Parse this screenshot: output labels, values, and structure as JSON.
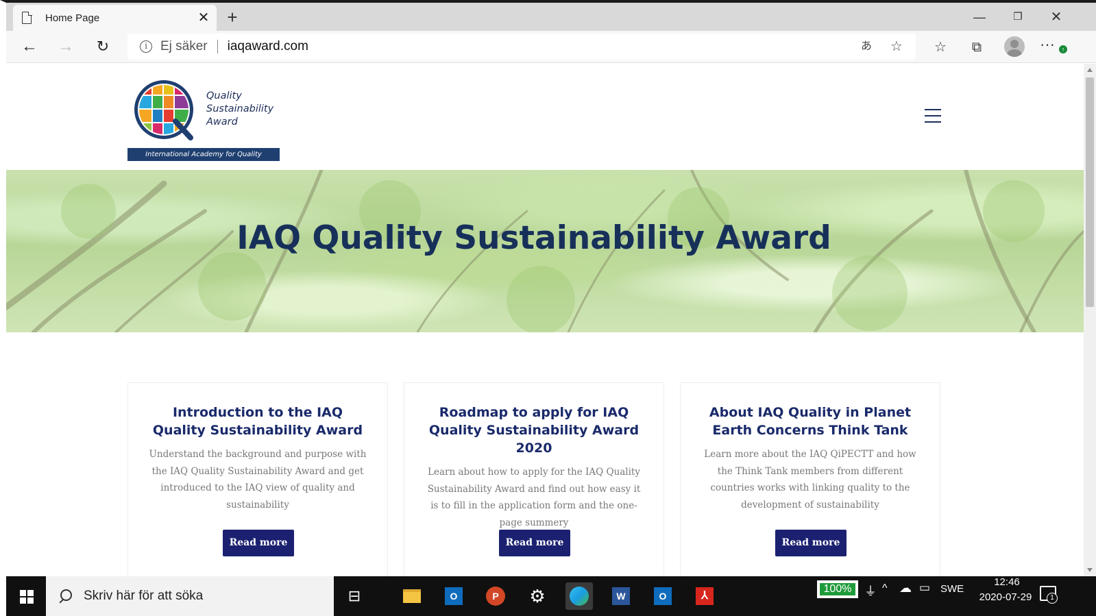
{
  "browser": {
    "tab_title": "Home Page",
    "security_label": "Ej säker",
    "url": "iaqaward.com",
    "icons": [
      "page-icon",
      "close-icon",
      "plus-icon",
      "back-arrow-icon",
      "forward-arrow-icon",
      "refresh-icon",
      "info-icon",
      "translate-icon",
      "star-icon",
      "favorites-icon",
      "collections-icon",
      "profile-icon",
      "more-icon"
    ]
  },
  "site": {
    "logo": {
      "line1": "Quality",
      "line2": "Sustainability",
      "line3": "Award",
      "tagline": "International Academy for Quality"
    },
    "hero_title": "IAQ Quality Sustainability Award",
    "cards": [
      {
        "title": "Introduction to the IAQ Quality Sustainability Award",
        "body": "Understand the background and purpose with the IAQ Quality Sustainability Award and get introduced to the IAQ view of quality and sustainability",
        "button": "Read more"
      },
      {
        "title": "Roadmap to apply for IAQ Quality Sustainability Award 2020",
        "body": "Learn about how to apply for the IAQ Quality Sustainability Award and find out how easy it is to fill in the application form and the one-page summery",
        "button": "Read more"
      },
      {
        "title": "About IAQ Quality in Planet Earth Concerns Think Tank",
        "body": "Learn more about the IAQ QiPECTT and how the Think Tank members from different countries works with linking quality to the development of sustainability",
        "button": "Read more"
      }
    ],
    "colors": {
      "title_navy": "#17305a",
      "card_title": "#1a2a6b",
      "button_bg": "#1b2170",
      "logo_bar": "#1f3f70"
    }
  },
  "taskbar": {
    "search_placeholder": "Skriv här för att söka",
    "battery": "100%",
    "language": "SWE",
    "time": "12:46",
    "date": "2020-07-29",
    "notification_count": "1"
  }
}
